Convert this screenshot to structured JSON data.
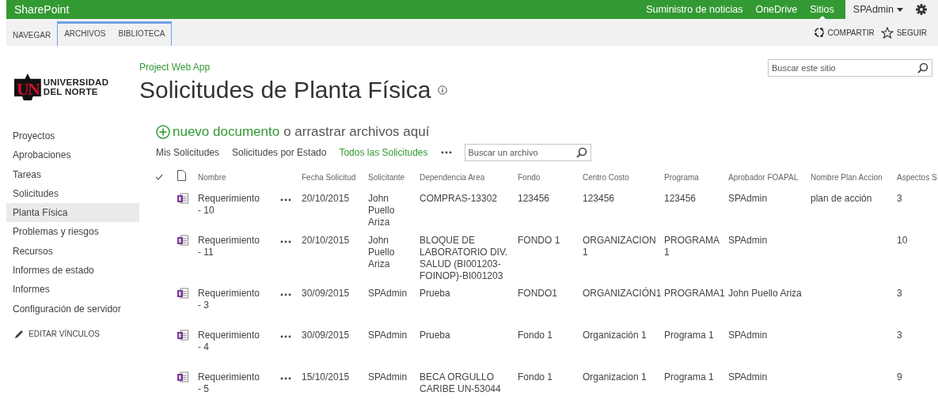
{
  "suite_bar": {
    "brand": "SharePoint",
    "links": [
      {
        "label": "Suministro de noticias",
        "selected": false
      },
      {
        "label": "OneDrive",
        "selected": false
      },
      {
        "label": "Sitios",
        "selected": true
      }
    ],
    "user": "SPAdmin"
  },
  "ribbon": {
    "tabs": [
      {
        "label": "NAVEGAR",
        "kind": "plain"
      },
      {
        "label": "ARCHIVOS",
        "kind": "contextual"
      },
      {
        "label": "BIBLIOTECA",
        "kind": "contextual"
      }
    ],
    "actions": [
      {
        "label": "COMPARTIR",
        "kind": "share"
      },
      {
        "label": "SEGUIR",
        "kind": "follow"
      }
    ]
  },
  "logo": {
    "mark": "UN",
    "lines": [
      "UNIVERSIDAD",
      "DEL NORTE"
    ]
  },
  "breadcrumb": "Project Web App",
  "page_title": "Solicitudes de Planta Física",
  "site_search": {
    "placeholder": "Buscar este sitio"
  },
  "sidebar": {
    "items": [
      {
        "label": "Proyectos",
        "selected": false
      },
      {
        "label": "Aprobaciones",
        "selected": false
      },
      {
        "label": "Tareas",
        "selected": false
      },
      {
        "label": "Solicitudes",
        "selected": false
      },
      {
        "label": "Planta Física",
        "selected": true
      },
      {
        "label": "Problemas y riesgos",
        "selected": false
      },
      {
        "label": "Recursos",
        "selected": false
      },
      {
        "label": "Informes de estado",
        "selected": false
      },
      {
        "label": "Informes",
        "selected": false
      },
      {
        "label": "Configuración de servidor",
        "selected": false
      }
    ],
    "edit_links": "EDITAR VÍNCULOS"
  },
  "new_document": {
    "link": "nuevo documento",
    "rest": "o arrastrar archivos aquí"
  },
  "views": [
    {
      "label": "Mis Solicitudes",
      "selected": false
    },
    {
      "label": "Solicitudes por Estado",
      "selected": false
    },
    {
      "label": "Todos las Solicitudes",
      "selected": true
    }
  ],
  "file_search": {
    "placeholder": "Buscar un archivo"
  },
  "table": {
    "columns": [
      "Nombre",
      "Fecha Solicitud",
      "Solicitante",
      "Dependencia Area",
      "Fondo",
      "Centro Costo",
      "Programa",
      "Aprobador FOAPAL",
      "Nombre Plan Accion",
      "Aspectos S"
    ],
    "rows": [
      [
        "Requerimiento - 10",
        "20/10/2015",
        "John Puello Ariza",
        "COMPRAS-13302",
        "123456",
        "123456",
        "123456",
        "SPAdmin",
        "plan de acción",
        "3"
      ],
      [
        "Requerimiento - 11",
        "20/10/2015",
        "John Puello Ariza",
        "BLOQUE DE LABORATORIO DIV. SALUD (BI001203-FOINOP)-BI001203",
        "FONDO 1",
        "ORGANIZACION 1",
        "PROGRAMA 1",
        "SPAdmin",
        "",
        "10"
      ],
      [
        "Requerimiento - 3",
        "30/09/2015",
        "SPAdmin",
        "Prueba",
        "FONDO1",
        "ORGANIZACIÓN1",
        "PROGRAMA1",
        "John Puello Ariza",
        "",
        "3"
      ],
      [
        "Requerimiento - 4",
        "30/09/2015",
        "SPAdmin",
        "Prueba",
        "Fondo 1",
        "Organización 1",
        "Programa 1",
        "SPAdmin",
        "",
        "3"
      ],
      [
        "Requerimiento - 5",
        "15/10/2015",
        "SPAdmin",
        "BECA ORGULLO CARIBE UN-53044",
        "Fondo 1",
        "Organizacion 1",
        "Programa 1",
        "SPAdmin",
        "",
        "9"
      ]
    ]
  }
}
